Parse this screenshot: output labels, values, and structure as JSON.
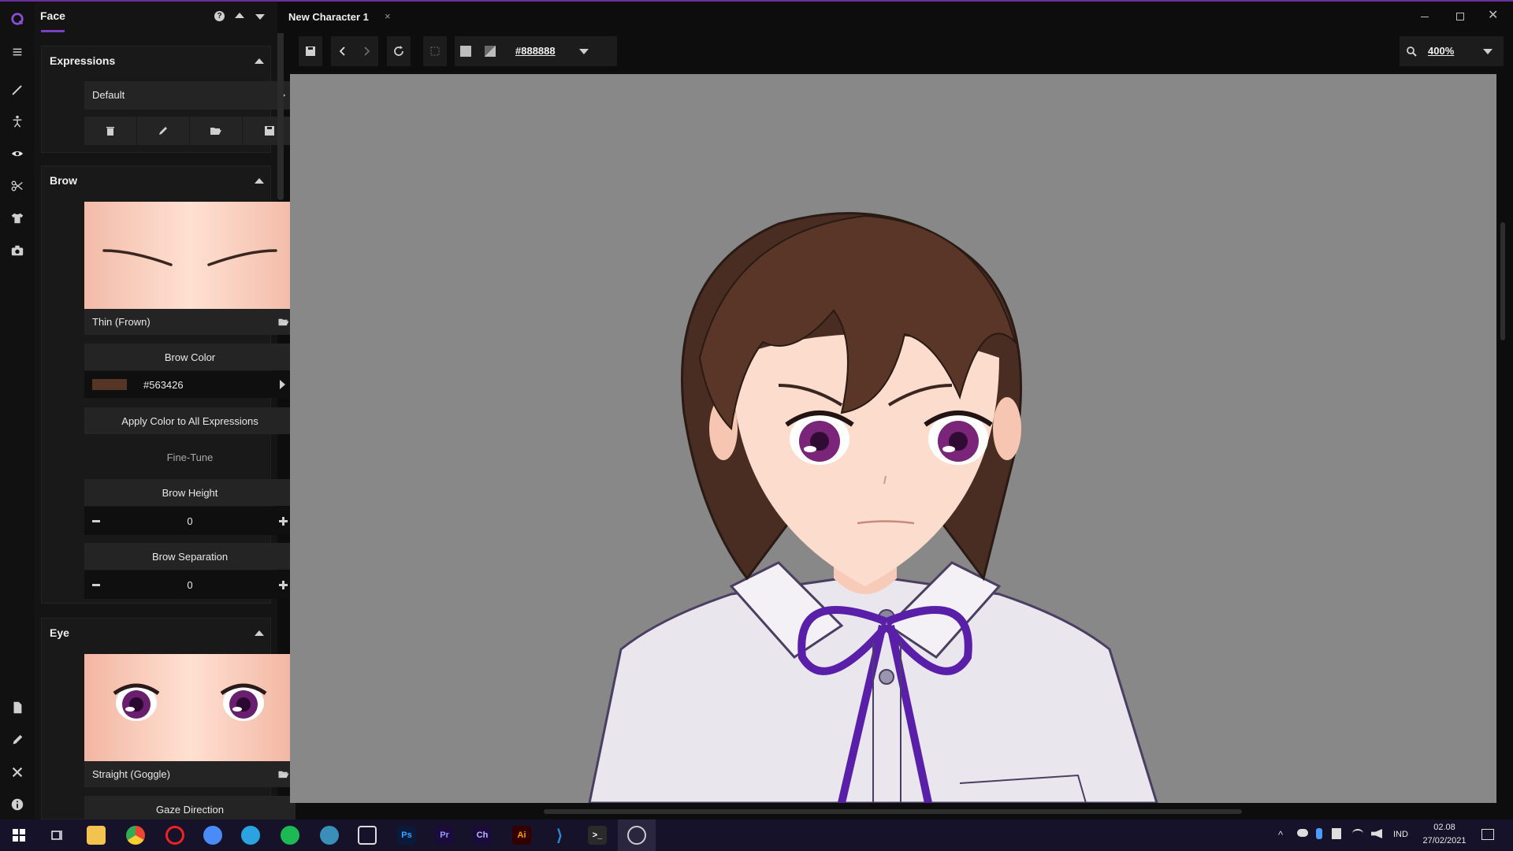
{
  "app": {
    "logo": "app-logo-icon",
    "accent": "#7b3fbf"
  },
  "rail": {
    "top": [
      "menu-icon",
      "brush-icon",
      "figure-icon",
      "eye-icon",
      "scissors-icon",
      "shirt-icon",
      "camera-icon"
    ],
    "bottom": [
      "file-icon",
      "pencil-icon",
      "tools-icon",
      "info-icon"
    ]
  },
  "panel": {
    "title": "Face",
    "expressions": {
      "title": "Expressions",
      "selected": "Default"
    },
    "brow": {
      "title": "Brow",
      "preset": "Thin (Frown)",
      "color_title": "Brow Color",
      "color_value": "#563426",
      "apply_all": "Apply Color to All Expressions",
      "finetune": "Fine-Tune",
      "height_label": "Brow Height",
      "height_value": "0",
      "sep_label": "Brow Separation",
      "sep_value": "0"
    },
    "eye": {
      "title": "Eye",
      "preset": "Straight (Goggle)",
      "gaze": "Gaze Direction"
    }
  },
  "tab": {
    "label": "New Character 1",
    "close": "×"
  },
  "toolbar": {
    "bg_color": "#888888",
    "zoom": "400%"
  },
  "taskbar": {
    "lang": "IND",
    "time": "02.08",
    "date": "27/02/2021",
    "apps": [
      "Ps",
      "Pr",
      "Ch",
      "Ai"
    ]
  }
}
